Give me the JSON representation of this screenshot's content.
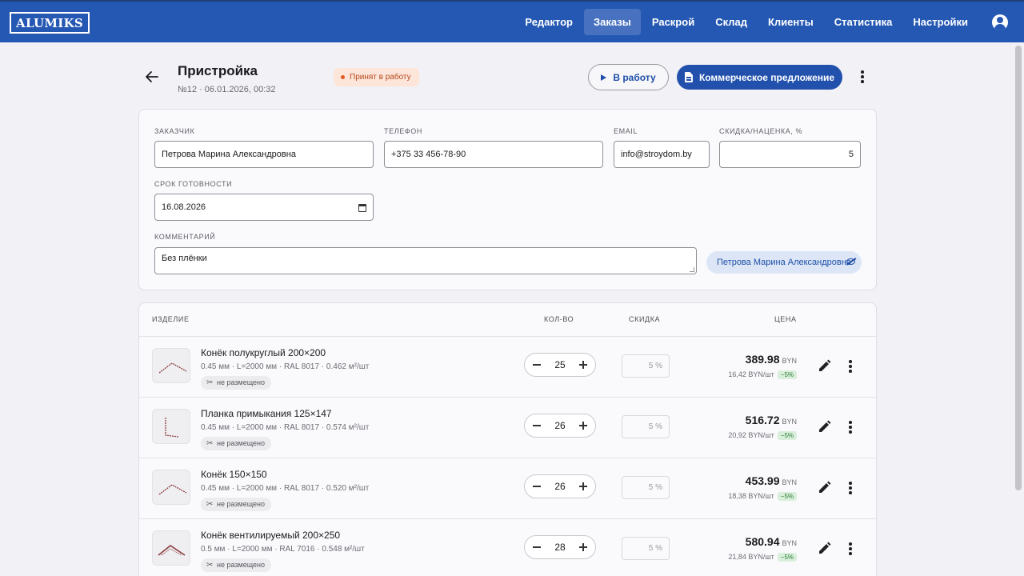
{
  "app": {
    "logo": "ALUMIKS",
    "nav": [
      "Редактор",
      "Заказы",
      "Раскрой",
      "Склад",
      "Клиенты",
      "Статистика",
      "Настройки"
    ],
    "active_nav": "Заказы"
  },
  "order": {
    "title": "Пристройка",
    "subtitle": "№12 · 06.01.2026, 00:32",
    "status": "Принят в работу",
    "to_work_label": "В работу",
    "proposal_label": "Коммерческое предложение"
  },
  "form": {
    "customer_label": "Заказчик",
    "customer": "Петрова Марина Александровна",
    "phone_label": "Телефон",
    "phone": "+375 33 456-78-90",
    "email_label": "Email",
    "email": "info@stroydom.by",
    "discount_label": "Скидка/наценка, %",
    "discount": "5",
    "deadline_label": "Срок готовности",
    "deadline": "16.08.2026",
    "comment_label": "Комментарий",
    "comment": "Без плёнки",
    "client_chip": "Петрова Марина Александровна"
  },
  "table": {
    "headers": {
      "item": "Изделие",
      "qty": "Кол-во",
      "discount": "Скидка",
      "price": "Цена"
    },
    "rows": [
      {
        "name": "Конёк полукруглый 200×200",
        "spec": "0.45 мм · L=2000 мм · RAL 8017 · 0.462 м²/шт",
        "tag": "не размещено",
        "qty": "25",
        "discount": "5 %",
        "price": "389.98",
        "currency": "BYN",
        "unit_price": "16,42 BYN/шт",
        "unit_badge": "−5%",
        "shape": "ridge"
      },
      {
        "name": "Планка примыкания 125×147",
        "spec": "0.45 мм · L=2000 мм · RAL 8017 · 0.574 м²/шт",
        "tag": "не размещено",
        "qty": "26",
        "discount": "5 %",
        "price": "516.72",
        "currency": "BYN",
        "unit_price": "20,92 BYN/шт",
        "unit_badge": "−5%",
        "shape": "corner"
      },
      {
        "name": "Конёк 150×150",
        "spec": "0.45 мм · L=2000 мм · RAL 8017 · 0.520 м²/шт",
        "tag": "не размещено",
        "qty": "26",
        "discount": "5 %",
        "price": "453.99",
        "currency": "BYN",
        "unit_price": "18,38 BYN/шт",
        "unit_badge": "−5%",
        "shape": "ridge"
      },
      {
        "name": "Конёк вентилируемый 200×250",
        "spec": "0.5 мм · L=2000 мм · RAL 7016 · 0.548 м²/шт",
        "tag": "не размещено",
        "qty": "28",
        "discount": "5 %",
        "price": "580.94",
        "currency": "BYN",
        "unit_price": "21,84 BYN/шт",
        "unit_badge": "−5%",
        "shape": "ridge-vent"
      }
    ]
  }
}
